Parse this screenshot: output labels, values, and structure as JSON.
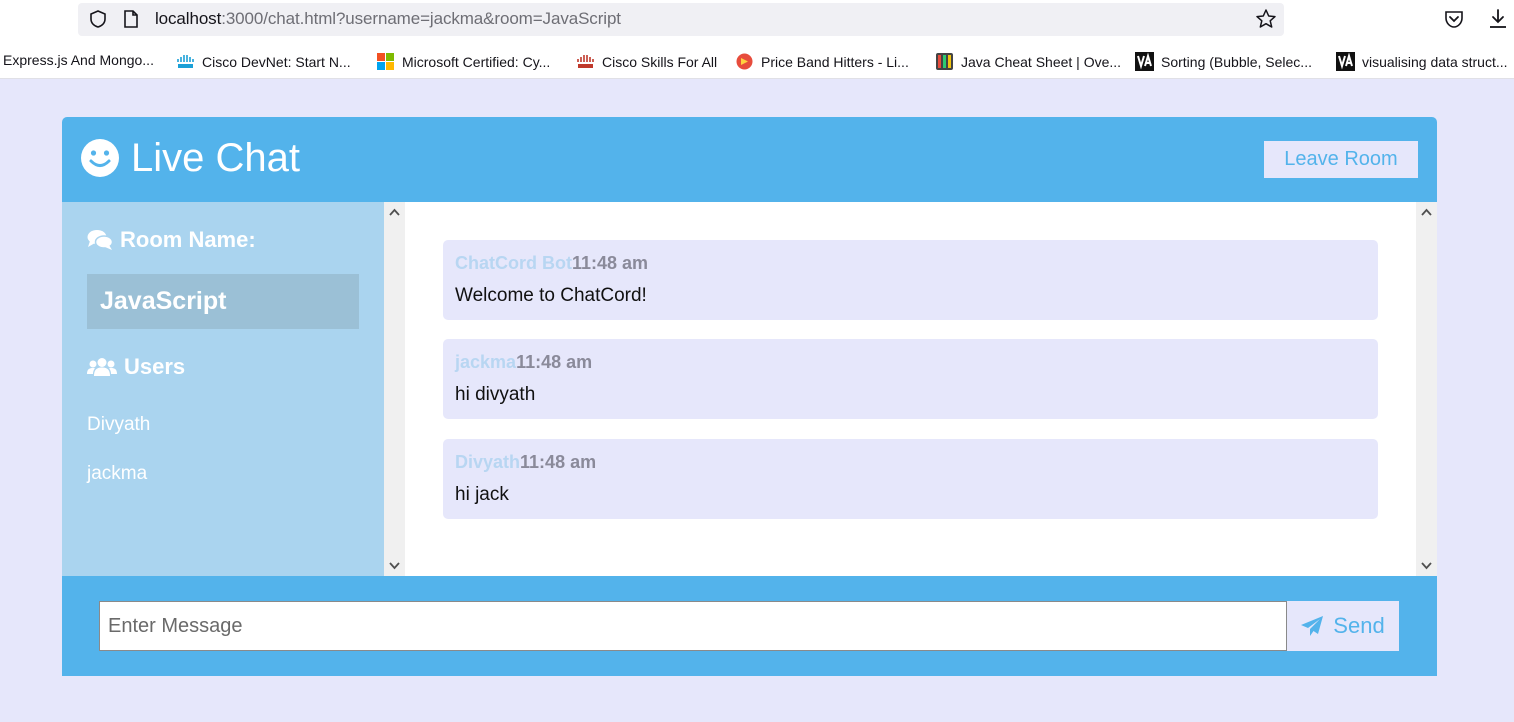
{
  "browser": {
    "url_host": "localhost",
    "url_rest": ":3000/chat.html?username=jackma&room=JavaScript",
    "icons": [
      "shield-icon",
      "page-icon",
      "star-icon",
      "pocket-icon",
      "download-icon"
    ]
  },
  "bookmarks": [
    {
      "label": "Express.js And Mongo...",
      "icon": "none"
    },
    {
      "label": "Cisco DevNet: Start N...",
      "icon": "cisco-icon"
    },
    {
      "label": "Microsoft Certified: Cy...",
      "icon": "microsoft-icon"
    },
    {
      "label": "Cisco Skills For All",
      "icon": "cisco-icon"
    },
    {
      "label": "Price Band Hitters - Li...",
      "icon": "price-band-icon"
    },
    {
      "label": "Java Cheat Sheet | Ove...",
      "icon": "java-cheat-icon"
    },
    {
      "label": "Sorting (Bubble, Selec...",
      "icon": "visualgo-icon"
    },
    {
      "label": "visualising data struct...",
      "icon": "visualgo-icon"
    }
  ],
  "header": {
    "title": "Live Chat",
    "leave_label": "Leave Room"
  },
  "sidebar": {
    "room_heading": "Room Name:",
    "room_name": "JavaScript",
    "users_heading": "Users",
    "users": [
      "Divyath",
      "jackma"
    ]
  },
  "messages": [
    {
      "user": "ChatCord Bot",
      "time": "11:48 am",
      "text": "Welcome to ChatCord!"
    },
    {
      "user": "jackma",
      "time": "11:48 am",
      "text": "hi divyath"
    },
    {
      "user": "Divyath",
      "time": "11:48 am",
      "text": "hi jack"
    }
  ],
  "composer": {
    "placeholder": "Enter Message",
    "send_label": "Send"
  },
  "colors": {
    "accent": "#53b3eb",
    "light": "#e6e7fb",
    "sidebar": "#aad4ef",
    "room_box": "#9bc0d6"
  }
}
